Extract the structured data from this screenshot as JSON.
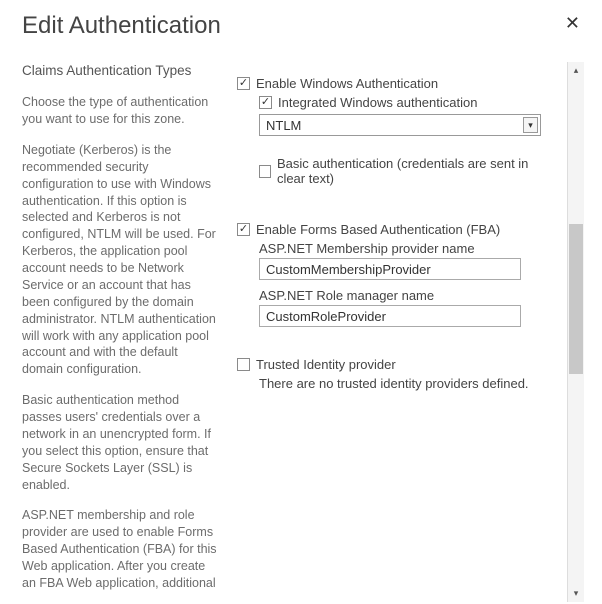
{
  "dialog": {
    "title": "Edit Authentication",
    "close_label": "✕"
  },
  "help": {
    "section_title": "Claims Authentication Types",
    "p1": "Choose the type of authentication you want to use for this zone.",
    "p2": "Negotiate (Kerberos) is the recommended security configuration to use with Windows authentication. If this option is selected and Kerberos is not configured, NTLM will be used. For Kerberos, the application pool account needs to be Network Service or an account that has been configured by the domain administrator. NTLM authentication will work with any application pool account and with the default domain configuration.",
    "p3": "Basic authentication method passes users' credentials over a network in an unencrypted form. If you select this option, ensure that Secure Sockets Layer (SSL) is enabled.",
    "p4": "ASP.NET membership and role provider are used to enable Forms Based Authentication (FBA) for this Web application. After you create an FBA Web application, additional"
  },
  "form": {
    "enable_windows_auth": {
      "label": "Enable Windows Authentication",
      "checked": true
    },
    "integrated_windows": {
      "label": "Integrated Windows authentication",
      "checked": true
    },
    "ntlm_select": {
      "value": "NTLM"
    },
    "basic_auth": {
      "label": "Basic authentication (credentials are sent in clear text)",
      "checked": false
    },
    "enable_fba": {
      "label": "Enable Forms Based Authentication (FBA)",
      "checked": true
    },
    "membership_label": "ASP.NET Membership provider name",
    "membership_value": "CustomMembershipProvider",
    "role_label": "ASP.NET Role manager name",
    "role_value": "CustomRoleProvider",
    "trusted": {
      "label": "Trusted Identity provider",
      "checked": false
    },
    "trusted_msg": "There are no trusted identity providers defined."
  }
}
